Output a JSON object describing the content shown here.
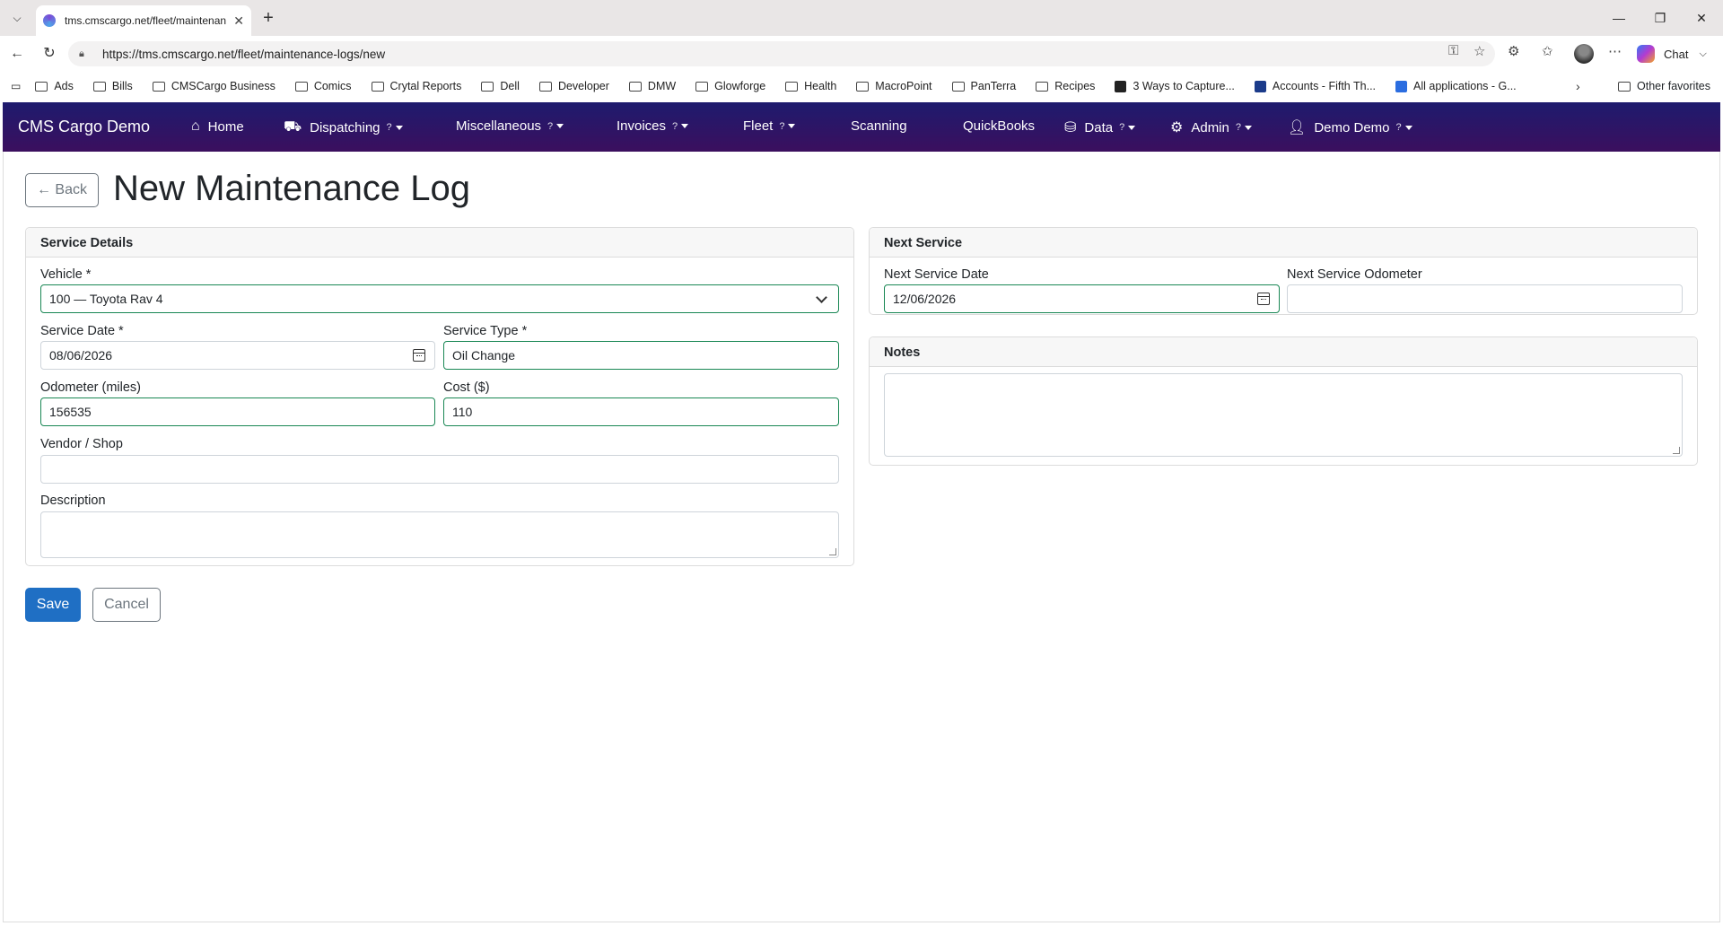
{
  "browser": {
    "tab_title": "tms.cmscargo.net/fleet/maintenan",
    "url": "https://tms.cmscargo.net/fleet/maintenance-logs/new",
    "copilot_label": "Chat",
    "bookmarks": [
      "Ads",
      "Bills",
      "CMSCargo Business",
      "Comics",
      "Crytal Reports",
      "Dell",
      "Developer",
      "DMW",
      "Glowforge",
      "Health",
      "MacroPoint",
      "PanTerra",
      "Recipes",
      "3 Ways to Capture...",
      "Accounts - Fifth Th...",
      "All applications - G..."
    ],
    "other_favorites": "Other favorites"
  },
  "navbar": {
    "brand": "CMS Cargo Demo",
    "home": "Home",
    "dispatching": "Dispatching",
    "miscellaneous": "Miscellaneous",
    "invoices": "Invoices",
    "fleet": "Fleet",
    "scanning": "Scanning",
    "quickbooks": "QuickBooks",
    "data": "Data",
    "admin": "Admin",
    "user": "Demo Demo",
    "help_mark": "?"
  },
  "page": {
    "back_label": "← Back",
    "title": "New Maintenance Log"
  },
  "service_details": {
    "header": "Service Details",
    "vehicle_label": "Vehicle *",
    "vehicle_value": "100 — Toyota Rav 4",
    "service_date_label": "Service Date *",
    "service_date_value": "08/06/2026",
    "service_type_label": "Service Type *",
    "service_type_value": "Oil Change",
    "odometer_label": "Odometer (miles)",
    "odometer_value": "156535",
    "cost_label": "Cost ($)",
    "cost_value": "110",
    "vendor_label": "Vendor / Shop",
    "vendor_value": "",
    "description_label": "Description"
  },
  "next_service": {
    "header": "Next Service",
    "date_label": "Next Service Date",
    "date_value": "12/06/2026",
    "odometer_label": "Next Service Odometer",
    "odometer_value": ""
  },
  "notes": {
    "header": "Notes"
  },
  "actions": {
    "save": "Save",
    "cancel": "Cancel"
  },
  "colors": {
    "navbar_start": "#1e1b6e",
    "navbar_end": "#3b0f5e",
    "valid_border": "#198754",
    "primary": "#1f6fc4"
  }
}
